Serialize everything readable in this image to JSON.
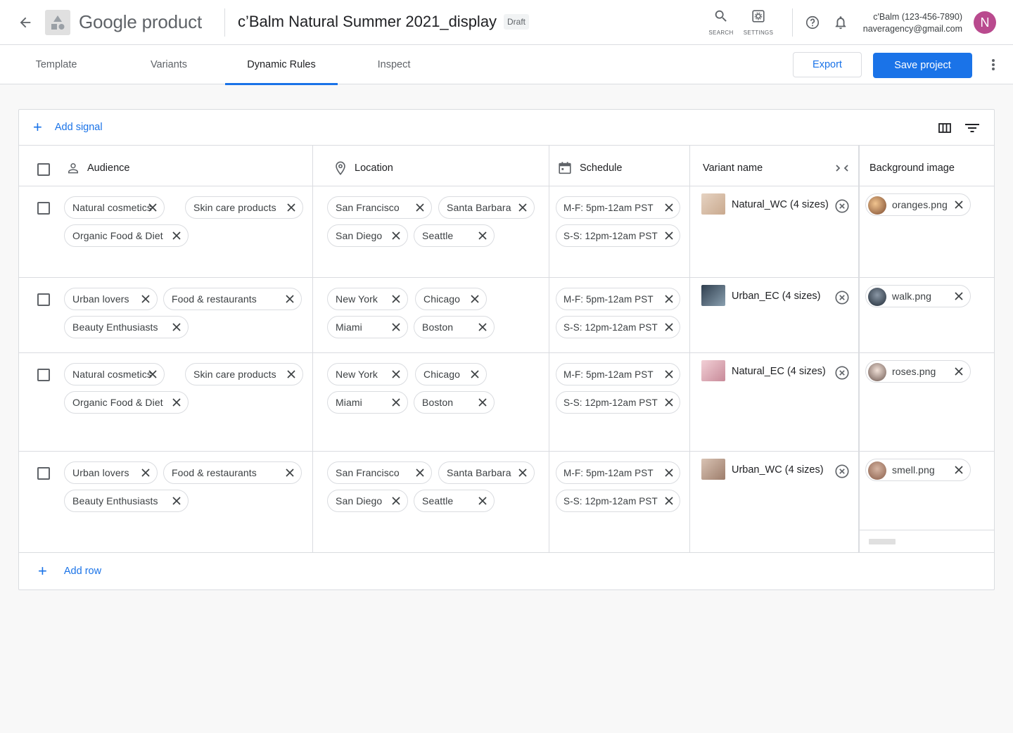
{
  "header": {
    "product_name": "Google product",
    "project_title": "c’Balm Natural Summer 2021_display",
    "status_badge": "Draft",
    "search_label": "SEARCH",
    "settings_label": "SETTINGS",
    "account_name": "c'Balm (123-456-7890)",
    "account_email": "naveragency@gmail.com",
    "avatar_letter": "N"
  },
  "tabs": [
    {
      "label": "Template"
    },
    {
      "label": "Variants"
    },
    {
      "label": "Dynamic Rules",
      "active": true
    },
    {
      "label": "Inspect"
    }
  ],
  "actions": {
    "export": "Export",
    "save": "Save project"
  },
  "toolbar": {
    "add_signal": "Add signal"
  },
  "columns": {
    "audience": "Audience",
    "location": "Location",
    "schedule": "Schedule",
    "variant": "Variant name",
    "background": "Background image"
  },
  "rows": [
    {
      "audience": [
        "Natural cosmetics",
        "Skin care products",
        "Organic Food & Diet"
      ],
      "location": [
        "San Francisco",
        "Santa Barbara",
        "San Diego",
        "Seattle"
      ],
      "schedule": [
        "M-F: 5pm-12am PST",
        "S-S: 12pm-12am PST"
      ],
      "variant": "Natural_WC (4 sizes)",
      "background": "oranges.png"
    },
    {
      "audience": [
        "Urban lovers",
        "Food & restaurants",
        "Beauty Enthusiasts"
      ],
      "location": [
        "New York",
        "Chicago",
        "Miami",
        "Boston"
      ],
      "schedule": [
        "M-F: 5pm-12am PST",
        "S-S: 12pm-12am PST"
      ],
      "variant": "Urban_EC (4 sizes)",
      "background": "walk.png"
    },
    {
      "audience": [
        "Natural cosmetics",
        "Skin care products",
        "Organic Food & Diet"
      ],
      "location": [
        "New York",
        "Chicago",
        "Miami",
        "Boston"
      ],
      "schedule": [
        "M-F: 5pm-12am PST",
        "S-S: 12pm-12am PST"
      ],
      "variant": "Natural_EC (4 sizes)",
      "background": "roses.png"
    },
    {
      "audience": [
        "Urban lovers",
        "Food & restaurants",
        "Beauty Enthusiasts"
      ],
      "location": [
        "San Francisco",
        "Santa Barbara",
        "San Diego",
        "Seattle"
      ],
      "schedule": [
        "M-F: 5pm-12am PST",
        "S-S: 12pm-12am PST"
      ],
      "variant": "Urban_WC (4 sizes)",
      "background": "smell.png"
    }
  ],
  "footer": {
    "add_row": "Add row"
  },
  "colors": {
    "accent": "#1a73e8",
    "avatar": "#b94a8e"
  }
}
